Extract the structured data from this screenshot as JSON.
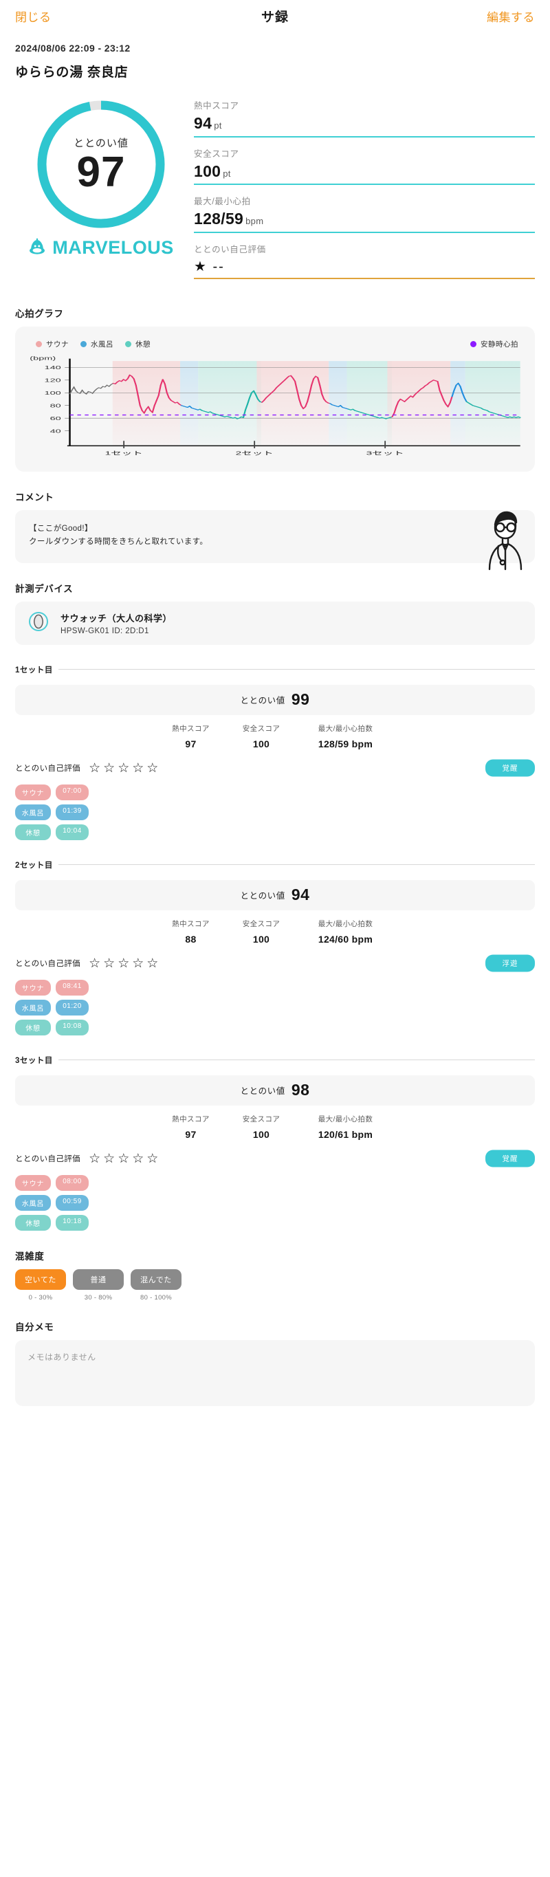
{
  "header": {
    "close_label": "閉じる",
    "title": "サ録",
    "edit_label": "編集する"
  },
  "session": {
    "datetime": "2024/08/06 22:09 - 23:12",
    "venue": "ゆららの湯 奈良店"
  },
  "summary": {
    "gauge_caption": "ととのい値",
    "gauge_value": "97",
    "gauge_percent": 97,
    "rank_text": "MARVELOUS",
    "accent_color": "#2fc4cd",
    "stats": [
      {
        "label": "熱中スコア",
        "value": "94",
        "unit": "pt"
      },
      {
        "label": "安全スコア",
        "value": "100",
        "unit": "pt"
      },
      {
        "label": "最大/最小心拍",
        "value": "128/59",
        "unit": "bpm"
      },
      {
        "label": "ととのい自己評価",
        "value": "★ --",
        "unit": ""
      }
    ]
  },
  "chart_section": {
    "title": "心拍グラフ"
  },
  "chart_data": {
    "type": "line",
    "title": "心拍グラフ",
    "ylabel": "(bpm)",
    "xlabel": "",
    "ylim": [
      30,
      150
    ],
    "yticks": [
      40,
      60,
      80,
      100,
      120,
      140
    ],
    "gridlines": [
      60,
      100,
      140
    ],
    "grid": true,
    "legend_position": "top",
    "legend": [
      {
        "name": "サウナ",
        "color": "#f0a8a8"
      },
      {
        "name": "水風呂",
        "color": "#4aa8d8"
      },
      {
        "name": "休憩",
        "color": "#5fcec0"
      }
    ],
    "reference_line": {
      "name": "安静時心拍",
      "value": 65,
      "color": "#8c1aff",
      "style": "dotted"
    },
    "xticks": [
      "1セット",
      "2セット",
      "3セット"
    ],
    "xtick_positions": [
      0.12,
      0.41,
      0.7
    ],
    "max_hr": 128,
    "min_hr": 59,
    "phases": [
      {
        "set": 1,
        "phase": "サウナ",
        "start": 0.095,
        "end": 0.245,
        "peak": 128,
        "start_hr": 98
      },
      {
        "set": 1,
        "phase": "水風呂",
        "start": 0.245,
        "end": 0.285,
        "peak": 128,
        "low": 68
      },
      {
        "set": 1,
        "phase": "休憩",
        "start": 0.285,
        "end": 0.425,
        "peak": 121,
        "low": 59
      },
      {
        "set": 2,
        "phase": "サウナ",
        "start": 0.415,
        "end": 0.575,
        "peak": 127,
        "start_hr": 73
      },
      {
        "set": 2,
        "phase": "水風呂",
        "start": 0.575,
        "end": 0.615,
        "peak": 124,
        "low": 74
      },
      {
        "set": 2,
        "phase": "休憩",
        "start": 0.615,
        "end": 0.715,
        "peak": 126,
        "low": 60
      },
      {
        "set": 3,
        "phase": "サウナ",
        "start": 0.705,
        "end": 0.845,
        "peak": 120,
        "start_hr": 62
      },
      {
        "set": 3,
        "phase": "水風呂",
        "start": 0.845,
        "end": 0.878,
        "peak": 104,
        "low": 74
      },
      {
        "set": 3,
        "phase": "休憩",
        "start": 0.878,
        "end": 1.0,
        "peak": 115,
        "low": 61
      }
    ],
    "series": [
      {
        "name": "心拍",
        "unit": "bpm",
        "values": [
          98,
          104,
          109,
          103,
          100,
          99,
          104,
          100,
          98,
          102,
          101,
          99,
          103,
          106,
          108,
          107,
          110,
          109,
          112,
          110,
          113,
          115,
          114,
          117,
          119,
          118,
          121,
          119,
          122,
          128,
          126,
          122,
          112,
          96,
          80,
          72,
          68,
          74,
          78,
          72,
          69,
          80,
          88,
          96,
          112,
          121,
          114,
          100,
          92,
          88,
          86,
          84,
          85,
          82,
          80,
          79,
          78,
          77,
          79,
          76,
          75,
          74,
          73,
          74,
          72,
          71,
          70,
          69,
          70,
          68,
          67,
          66,
          65,
          64,
          63,
          62,
          63,
          62,
          61,
          60,
          61,
          59,
          60,
          62,
          61,
          73,
          82,
          92,
          100,
          103,
          97,
          90,
          86,
          85,
          88,
          92,
          95,
          98,
          101,
          104,
          108,
          111,
          114,
          117,
          120,
          123,
          126,
          127,
          123,
          118,
          104,
          90,
          80,
          75,
          78,
          86,
          98,
          112,
          122,
          126,
          124,
          112,
          98,
          90,
          86,
          84,
          83,
          81,
          80,
          79,
          78,
          80,
          77,
          76,
          75,
          74,
          73,
          74,
          72,
          71,
          70,
          69,
          68,
          67,
          66,
          65,
          64,
          63,
          62,
          61,
          60,
          61,
          60,
          59,
          60,
          61,
          62,
          68,
          78,
          86,
          90,
          88,
          86,
          89,
          92,
          95,
          93,
          97,
          100,
          103,
          106,
          108,
          111,
          113,
          116,
          118,
          120,
          119,
          118,
          104,
          96,
          88,
          82,
          78,
          84,
          94,
          104,
          112,
          115,
          110,
          100,
          92,
          86,
          84,
          82,
          80,
          79,
          78,
          77,
          76,
          74,
          73,
          72,
          70,
          69,
          68,
          67,
          66,
          65,
          64,
          63,
          62,
          61,
          62,
          61,
          62,
          61,
          62,
          61
        ]
      }
    ]
  },
  "comment_section": {
    "title": "コメント",
    "lines": [
      "【ここがGood!】",
      "クールダウンする時間をきちんと取れています。"
    ]
  },
  "device_section": {
    "title": "計測デバイス",
    "name": "サウォッチ（大人の科学）",
    "detail": "HPSW-GK01  ID: 2D:D1"
  },
  "sets": [
    {
      "heading": "1セット目",
      "score_label": "ととのい値",
      "score_value": "99",
      "metrics": [
        {
          "label": "熱中スコア",
          "value": "97"
        },
        {
          "label": "安全スコア",
          "value": "100"
        },
        {
          "label": "最大/最小心拍数",
          "value": "128/59 bpm"
        }
      ],
      "rating_label": "ととのい自己評価",
      "stars": [
        "☆",
        "☆",
        "☆",
        "☆",
        "☆"
      ],
      "state_label": "覚醒",
      "tags": [
        {
          "name": "サウナ",
          "time": "07:00",
          "kind": "sauna"
        },
        {
          "name": "水風呂",
          "time": "01:39",
          "kind": "bath"
        },
        {
          "name": "休憩",
          "time": "10:04",
          "kind": "rest"
        }
      ]
    },
    {
      "heading": "2セット目",
      "score_label": "ととのい値",
      "score_value": "94",
      "metrics": [
        {
          "label": "熱中スコア",
          "value": "88"
        },
        {
          "label": "安全スコア",
          "value": "100"
        },
        {
          "label": "最大/最小心拍数",
          "value": "124/60 bpm"
        }
      ],
      "rating_label": "ととのい自己評価",
      "stars": [
        "☆",
        "☆",
        "☆",
        "☆",
        "☆"
      ],
      "state_label": "浮遊",
      "tags": [
        {
          "name": "サウナ",
          "time": "08:41",
          "kind": "sauna"
        },
        {
          "name": "水風呂",
          "time": "01:20",
          "kind": "bath"
        },
        {
          "name": "休憩",
          "time": "10:08",
          "kind": "rest"
        }
      ]
    },
    {
      "heading": "3セット目",
      "score_label": "ととのい値",
      "score_value": "98",
      "metrics": [
        {
          "label": "熱中スコア",
          "value": "97"
        },
        {
          "label": "安全スコア",
          "value": "100"
        },
        {
          "label": "最大/最小心拍数",
          "value": "120/61 bpm"
        }
      ],
      "rating_label": "ととのい自己評価",
      "stars": [
        "☆",
        "☆",
        "☆",
        "☆",
        "☆"
      ],
      "state_label": "覚醒",
      "tags": [
        {
          "name": "サウナ",
          "time": "08:00",
          "kind": "sauna"
        },
        {
          "name": "水風呂",
          "time": "00:59",
          "kind": "bath"
        },
        {
          "name": "休憩",
          "time": "10:18",
          "kind": "rest"
        }
      ]
    }
  ],
  "congestion": {
    "title": "混雑度",
    "options": [
      {
        "label": "空いてた",
        "range": "0 - 30%",
        "selected": true
      },
      {
        "label": "普通",
        "range": "30 - 80%",
        "selected": false
      },
      {
        "label": "混んでた",
        "range": "80 - 100%",
        "selected": false
      }
    ]
  },
  "memo": {
    "title": "自分メモ",
    "placeholder": "メモはありません"
  }
}
